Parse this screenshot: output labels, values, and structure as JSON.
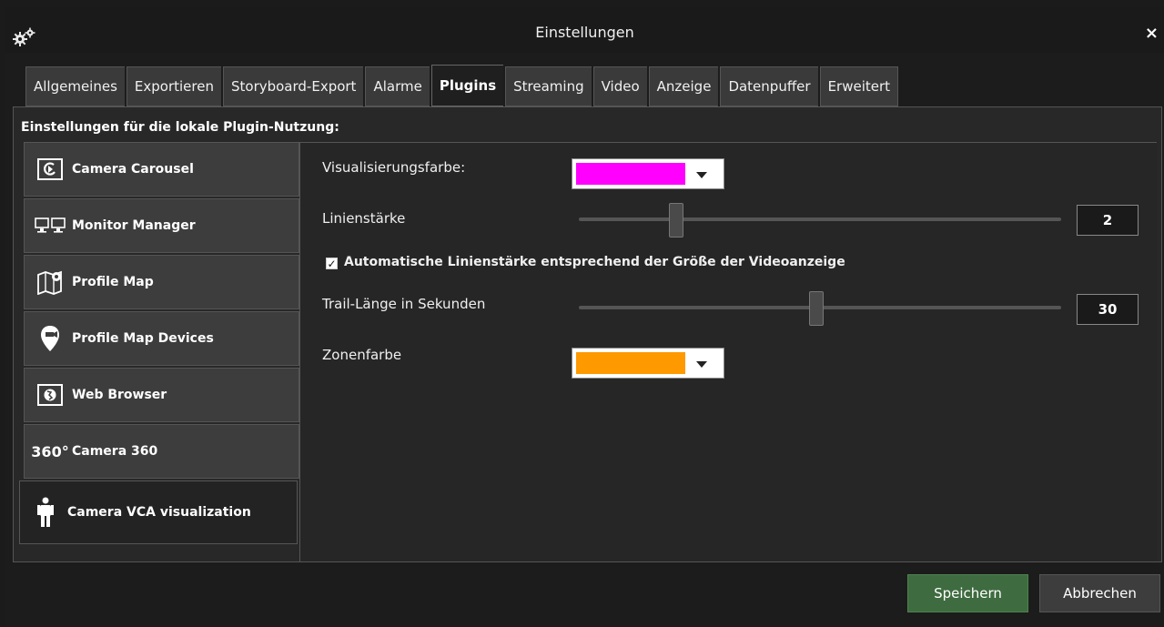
{
  "window": {
    "title": "Einstellungen",
    "close_label": "×"
  },
  "tabs": [
    {
      "label": "Allgemeines"
    },
    {
      "label": "Exportieren"
    },
    {
      "label": "Storyboard-Export"
    },
    {
      "label": "Alarme"
    },
    {
      "label": "Plugins",
      "active": true
    },
    {
      "label": "Streaming"
    },
    {
      "label": "Video"
    },
    {
      "label": "Anzeige"
    },
    {
      "label": "Datenpuffer"
    },
    {
      "label": "Erweitert"
    }
  ],
  "panel": {
    "header": "Einstellungen für die lokale Plugin-Nutzung:"
  },
  "sidebar": {
    "items": [
      {
        "label": "Camera Carousel",
        "icon": "camera-carousel-icon"
      },
      {
        "label": "Monitor Manager",
        "icon": "monitors-icon"
      },
      {
        "label": "Profile Map",
        "icon": "map-icon"
      },
      {
        "label": "Profile Map Devices",
        "icon": "map-pin-icon"
      },
      {
        "label": "Web Browser",
        "icon": "globe-icon"
      },
      {
        "label": "Camera 360",
        "icon": "360-icon",
        "icon_text": "360°"
      },
      {
        "label": "Camera VCA visualization",
        "icon": "person-icon",
        "active": true
      }
    ]
  },
  "settings": {
    "vis_color_label": "Visualisierungsfarbe:",
    "vis_color": "#ff00ff",
    "line_width_label": "Linienstärke",
    "line_width_value": "2",
    "auto_width_label": "Automatische Linienstärke entsprechend der Größe der Videoanzeige",
    "auto_width_checked": true,
    "trail_label": "Trail-Länge in Sekunden",
    "trail_value": "30",
    "zone_color_label": "Zonenfarbe",
    "zone_color": "#ff9900"
  },
  "buttons": {
    "save": "Speichern",
    "cancel": "Abbrechen"
  },
  "colors": {
    "save_button": "#3e6b3f",
    "background": "#1c1c1c"
  }
}
